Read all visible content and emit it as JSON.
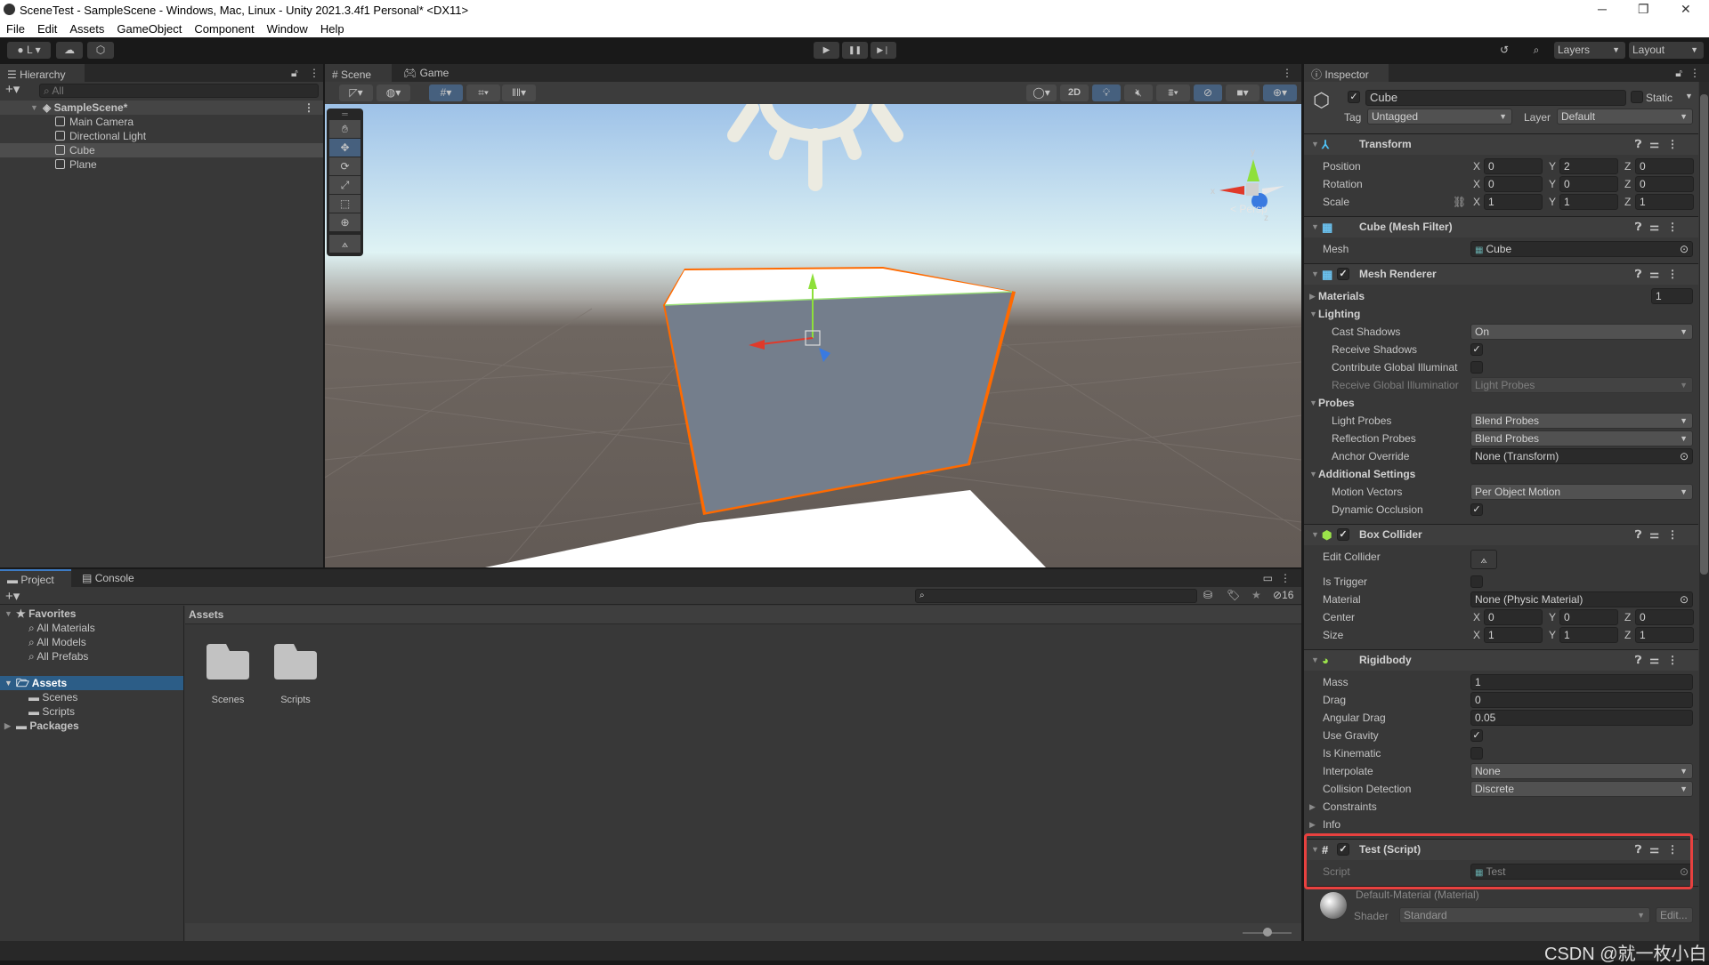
{
  "window": {
    "title": "SceneTest - SampleScene - Windows, Mac, Linux - Unity 2021.3.4f1 Personal* <DX11>",
    "minimize": "─",
    "maximize": "❐",
    "close": "✕"
  },
  "menu": [
    "File",
    "Edit",
    "Assets",
    "GameObject",
    "Component",
    "Window",
    "Help"
  ],
  "toolbar": {
    "account": "L",
    "layers": "Layers",
    "layout": "Layout",
    "play": "▶",
    "pause": "❚❚",
    "step": "▶❘"
  },
  "hierarchy": {
    "tab": "Hierarchy",
    "search_placeholder": "All",
    "scene": "SampleScene*",
    "items": [
      "Main Camera",
      "Directional Light",
      "Cube",
      "Plane"
    ],
    "selected": "Cube"
  },
  "scene": {
    "tabs": [
      "Scene",
      "Game"
    ],
    "toggle_2d": "2D",
    "persp": "Persp",
    "axes": [
      "x",
      "y",
      "z"
    ],
    "colors": {
      "selection_outline": "#ff6a00",
      "x_axis": "#e03a2a",
      "y_axis": "#8ee03a",
      "z_axis": "#3a7ae0"
    }
  },
  "inspector": {
    "tab": "Inspector",
    "object": {
      "name": "Cube",
      "active": true,
      "static_label": "Static",
      "static": false,
      "tag_label": "Tag",
      "tag": "Untagged",
      "layer_label": "Layer",
      "layer": "Default"
    },
    "axis_labels": [
      "X",
      "Y",
      "Z"
    ],
    "components": [
      {
        "name": "Transform",
        "icon": "transform-icon",
        "rows": [
          {
            "label": "Position",
            "type": "vec3",
            "values": [
              "0",
              "2",
              "0"
            ]
          },
          {
            "label": "Rotation",
            "type": "vec3",
            "values": [
              "0",
              "0",
              "0"
            ]
          },
          {
            "label": "Scale",
            "type": "vec3",
            "values": [
              "1",
              "1",
              "1"
            ],
            "link": true
          }
        ]
      },
      {
        "name": "Cube (Mesh Filter)",
        "icon": "mesh-filter-icon",
        "rows": [
          {
            "label": "Mesh",
            "type": "object",
            "value": "Cube",
            "icon": true
          }
        ]
      },
      {
        "name": "Mesh Renderer",
        "icon": "mesh-renderer-icon",
        "enabled": true,
        "rows": [
          {
            "label": "Materials",
            "type": "foldout",
            "open": false,
            "count": "1"
          },
          {
            "label": "Lighting",
            "type": "foldout",
            "open": true
          },
          {
            "label": "Cast Shadows",
            "type": "dropdown",
            "value": "On",
            "indent": 1
          },
          {
            "label": "Receive Shadows",
            "type": "check",
            "value": true,
            "indent": 1
          },
          {
            "label": "Contribute Global Illuminat",
            "type": "check",
            "value": false,
            "indent": 1
          },
          {
            "label": "Receive Global Illuminatior",
            "type": "dropdown",
            "value": "Light Probes",
            "indent": 1,
            "disabled": true
          },
          {
            "label": "Probes",
            "type": "foldout",
            "open": true
          },
          {
            "label": "Light Probes",
            "type": "dropdown",
            "value": "Blend Probes",
            "indent": 1
          },
          {
            "label": "Reflection Probes",
            "type": "dropdown",
            "value": "Blend Probes",
            "indent": 1
          },
          {
            "label": "Anchor Override",
            "type": "object",
            "value": "None (Transform)",
            "indent": 1
          },
          {
            "label": "Additional Settings",
            "type": "foldout",
            "open": true
          },
          {
            "label": "Motion Vectors",
            "type": "dropdown",
            "value": "Per Object Motion",
            "indent": 1
          },
          {
            "label": "Dynamic Occlusion",
            "type": "check",
            "value": true,
            "indent": 1
          }
        ]
      },
      {
        "name": "Box Collider",
        "icon": "box-collider-icon",
        "enabled": true,
        "rows": [
          {
            "label": "Edit Collider",
            "type": "button"
          },
          {
            "label": "Is Trigger",
            "type": "check",
            "value": false
          },
          {
            "label": "Material",
            "type": "object",
            "value": "None (Physic Material)"
          },
          {
            "label": "Center",
            "type": "vec3",
            "values": [
              "0",
              "0",
              "0"
            ]
          },
          {
            "label": "Size",
            "type": "vec3",
            "values": [
              "1",
              "1",
              "1"
            ]
          }
        ]
      },
      {
        "name": "Rigidbody",
        "icon": "rigidbody-icon",
        "rows": [
          {
            "label": "Mass",
            "type": "number",
            "value": "1"
          },
          {
            "label": "Drag",
            "type": "number",
            "value": "0"
          },
          {
            "label": "Angular Drag",
            "type": "number",
            "value": "0.05"
          },
          {
            "label": "Use Gravity",
            "type": "check",
            "value": true
          },
          {
            "label": "Is Kinematic",
            "type": "check",
            "value": false
          },
          {
            "label": "Interpolate",
            "type": "dropdown",
            "value": "None"
          },
          {
            "label": "Collision Detection",
            "type": "dropdown",
            "value": "Discrete"
          },
          {
            "label": "Constraints",
            "type": "foldout2",
            "open": false
          },
          {
            "label": "Info",
            "type": "foldout2",
            "open": false
          }
        ]
      },
      {
        "name": "Test (Script)",
        "icon": "script-icon",
        "enabled": true,
        "highlight": true,
        "rows": [
          {
            "label": "Script",
            "type": "object",
            "value": "Test",
            "icon": true,
            "disabled": true
          }
        ]
      }
    ],
    "material": {
      "name": "Default-Material (Material)",
      "shader_label": "Shader",
      "shader": "Standard",
      "edit": "Edit..."
    },
    "highlight_color": "#e8413f"
  },
  "project": {
    "tabs": [
      "Project",
      "Console"
    ],
    "favorites": "Favorites",
    "favorite_items": [
      "All Materials",
      "All Models",
      "All Prefabs"
    ],
    "assets": "Assets",
    "asset_children": [
      "Scenes",
      "Scripts"
    ],
    "packages": "Packages",
    "breadcrumb": "Assets",
    "folders": [
      "Scenes",
      "Scripts"
    ],
    "hidden_count": "16",
    "thumb_size": 0.5
  },
  "watermark": "CSDN @就一枚小白"
}
